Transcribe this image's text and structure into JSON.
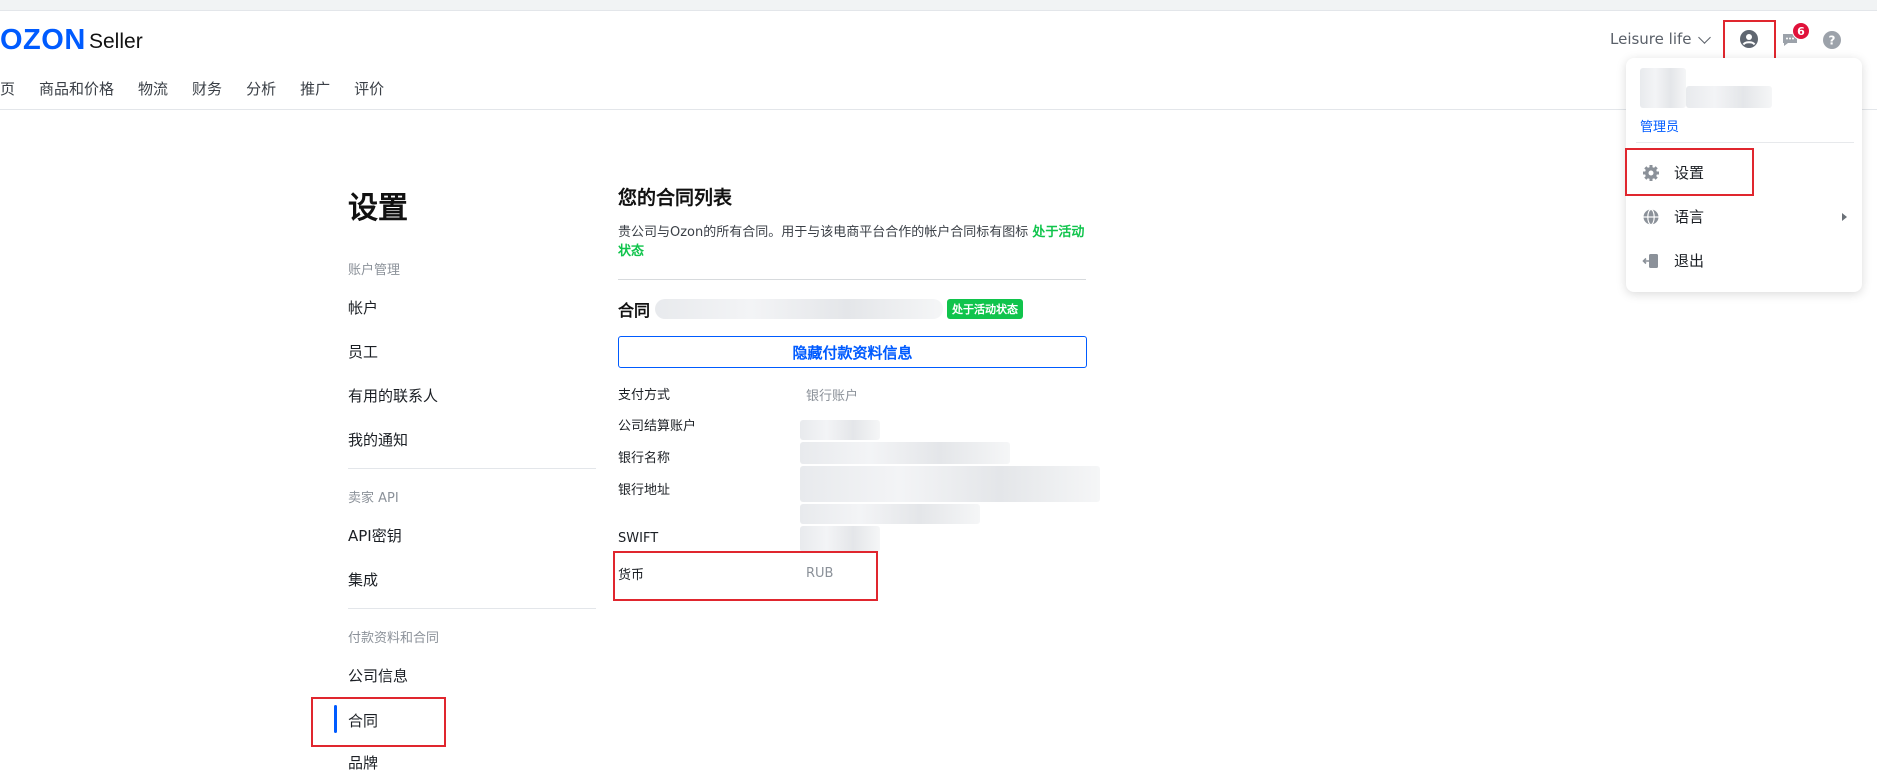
{
  "header": {
    "logo": "OZON",
    "logo_suffix": "Seller",
    "company": "Leisure life",
    "notification_count": "6"
  },
  "nav": [
    "首页",
    "商品和价格",
    "物流",
    "财务",
    "分析",
    "推广",
    "评价"
  ],
  "dropdown": {
    "role": "管理员",
    "items": [
      {
        "label": "设置",
        "icon": "gear-icon"
      },
      {
        "label": "语言",
        "icon": "globe-icon"
      },
      {
        "label": "退出",
        "icon": "logout-icon"
      }
    ]
  },
  "sidebar": {
    "title": "设置",
    "section_account": "账户管理",
    "account_items": [
      "帐户",
      "员工",
      "有用的联系人",
      "我的通知"
    ],
    "section_api": "卖家 API",
    "api_items": [
      "API密钥",
      "集成"
    ],
    "section_payment": "付款资料和合同",
    "payment_items": [
      "公司信息",
      "合同",
      "品牌"
    ]
  },
  "contracts": {
    "title": "您的合同列表",
    "description": "贵公司与Ozon的所有合同。用于与该电商平台合作的帐户合同标有图标",
    "description_status": "处于活动状态",
    "contract_label": "合同",
    "status_badge": "处于活动状态",
    "hide_button": "隐藏付款资料信息",
    "fields": [
      {
        "label": "支付方式",
        "value": "银行账户"
      },
      {
        "label": "公司结算账户",
        "value": ""
      },
      {
        "label": "银行名称",
        "value": ""
      },
      {
        "label": "银行地址",
        "value": ""
      },
      {
        "label": "SWIFT",
        "value": ""
      },
      {
        "label": "货币",
        "value": "RUB"
      }
    ]
  },
  "colors": {
    "brand": "#005bff",
    "active_green": "#10c44c",
    "highlight_red": "#e0262e",
    "badge_red": "#e0123a"
  }
}
